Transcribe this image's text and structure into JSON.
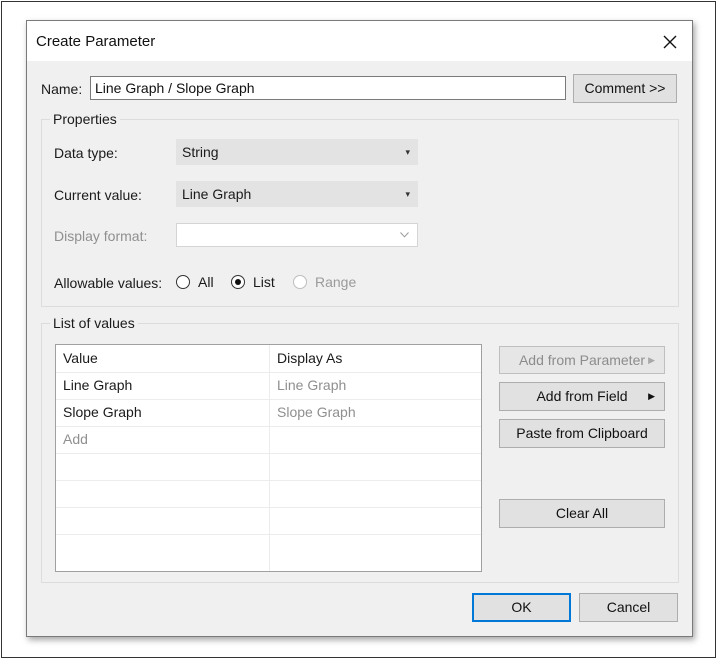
{
  "dialog": {
    "title": "Create Parameter",
    "close_icon": "close-icon"
  },
  "name_label": "Name:",
  "name_value": "Line Graph / Slope Graph",
  "comment_button": "Comment >>",
  "properties": {
    "title": "Properties",
    "data_type_label": "Data type:",
    "data_type_value": "String",
    "current_value_label": "Current value:",
    "current_value_value": "Line Graph",
    "display_format_label": "Display format:",
    "display_format_value": "",
    "allowable_label": "Allowable values:",
    "options": [
      {
        "label": "All",
        "selected": false,
        "disabled": false
      },
      {
        "label": "List",
        "selected": true,
        "disabled": false
      },
      {
        "label": "Range",
        "selected": false,
        "disabled": true
      }
    ]
  },
  "list": {
    "title": "List of values",
    "columns": [
      "Value",
      "Display As"
    ],
    "rows": [
      {
        "value": "Line Graph",
        "display": "Line Graph"
      },
      {
        "value": "Slope Graph",
        "display": "Slope Graph"
      }
    ],
    "add_placeholder": "Add",
    "buttons": {
      "add_from_parameter": "Add from Parameter",
      "add_from_field": "Add from Field",
      "paste_from_clipboard": "Paste from Clipboard",
      "clear_all": "Clear All"
    }
  },
  "footer": {
    "ok": "OK",
    "cancel": "Cancel"
  },
  "colors": {
    "dialog_bg": "#f0f0f0",
    "accent": "#0078d7"
  }
}
